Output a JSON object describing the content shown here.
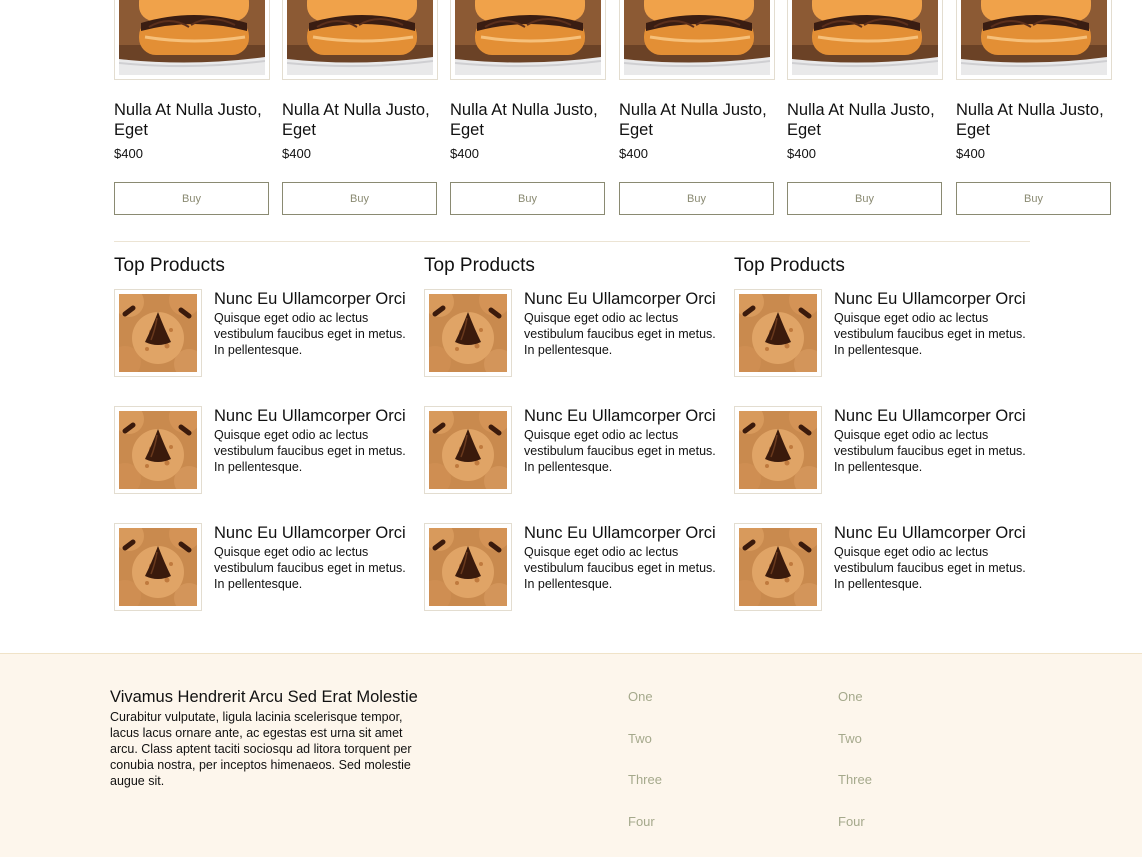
{
  "products": [
    {
      "title": "Nulla At Nulla Justo, Eget",
      "price": "$400",
      "buy_label": "Buy"
    },
    {
      "title": "Nulla At Nulla Justo, Eget",
      "price": "$400",
      "buy_label": "Buy"
    },
    {
      "title": "Nulla At Nulla Justo, Eget",
      "price": "$400",
      "buy_label": "Buy"
    },
    {
      "title": "Nulla At Nulla Justo, Eget",
      "price": "$400",
      "buy_label": "Buy"
    },
    {
      "title": "Nulla At Nulla Justo, Eget",
      "price": "$400",
      "buy_label": "Buy"
    },
    {
      "title": "Nulla At Nulla Justo, Eget",
      "price": "$400",
      "buy_label": "Buy"
    }
  ],
  "top_products": [
    {
      "title": "Top Products",
      "items": [
        {
          "name": "Nunc Eu Ullamcorper Orci",
          "desc": "Quisque eget odio ac lectus vestibulum faucibus eget in metus. In pellentesque."
        },
        {
          "name": "Nunc Eu Ullamcorper Orci",
          "desc": "Quisque eget odio ac lectus vestibulum faucibus eget in metus. In pellentesque."
        },
        {
          "name": "Nunc Eu Ullamcorper Orci",
          "desc": "Quisque eget odio ac lectus vestibulum faucibus eget in metus. In pellentesque."
        }
      ]
    },
    {
      "title": "Top Products",
      "items": [
        {
          "name": "Nunc Eu Ullamcorper Orci",
          "desc": "Quisque eget odio ac lectus vestibulum faucibus eget in metus. In pellentesque."
        },
        {
          "name": "Nunc Eu Ullamcorper Orci",
          "desc": "Quisque eget odio ac lectus vestibulum faucibus eget in metus. In pellentesque."
        },
        {
          "name": "Nunc Eu Ullamcorper Orci",
          "desc": "Quisque eget odio ac lectus vestibulum faucibus eget in metus. In pellentesque."
        }
      ]
    },
    {
      "title": "Top Products",
      "items": [
        {
          "name": "Nunc Eu Ullamcorper Orci",
          "desc": "Quisque eget odio ac lectus vestibulum faucibus eget in metus. In pellentesque."
        },
        {
          "name": "Nunc Eu Ullamcorper Orci",
          "desc": "Quisque eget odio ac lectus vestibulum faucibus eget in metus. In pellentesque."
        },
        {
          "name": "Nunc Eu Ullamcorper Orci",
          "desc": "Quisque eget odio ac lectus vestibulum faucibus eget in metus. In pellentesque."
        }
      ]
    }
  ],
  "footer": {
    "title": "Vivamus Hendrerit Arcu Sed Erat Molestie",
    "text": "Curabitur vulputate, ligula lacinia scelerisque tempor, lacus lacus ornare ante, ac egestas est urna sit amet arcu. Class aptent taciti sociosqu ad litora torquent per conubia nostra, per inceptos himenaeos. Sed molestie augue sit.",
    "links_col1": [
      "One",
      "Two",
      "Three",
      "Four"
    ],
    "links_col2": [
      "One",
      "Two",
      "Three",
      "Four"
    ]
  },
  "colors": {
    "accent": "#8a8a72",
    "link": "#a5a98c",
    "footer_bg": "#fdf6ec",
    "border": "#e3ddd0"
  },
  "images": {
    "product_image": "eclair-with-chocolate-icing",
    "top_product_image": "peanut-butter-blossom-cookies"
  }
}
